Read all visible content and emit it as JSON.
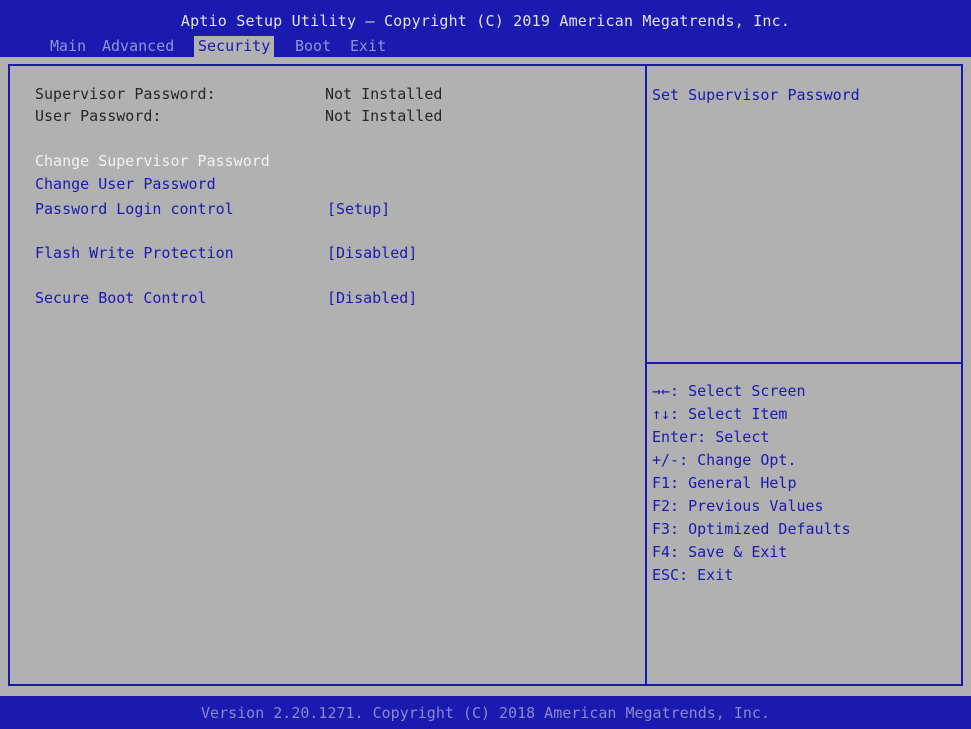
{
  "header": {
    "title": "Aptio Setup Utility – Copyright (C) 2019 American Megatrends, Inc.",
    "tabs": [
      {
        "label": "Main"
      },
      {
        "label": "Advanced"
      },
      {
        "label": "Security"
      },
      {
        "label": "Boot"
      },
      {
        "label": "Exit"
      }
    ],
    "active_tab": "Security"
  },
  "main": {
    "info": [
      {
        "label": "Supervisor Password:",
        "value": "Not Installed"
      },
      {
        "label": "User Password:",
        "value": "Not Installed"
      }
    ],
    "items": [
      {
        "label": "Change Supervisor Password",
        "value": ""
      },
      {
        "label": "Change User Password",
        "value": ""
      },
      {
        "label": "Password Login control",
        "value": "[Setup]"
      },
      {
        "label": "Flash Write Protection",
        "value": "[Disabled]"
      },
      {
        "label": "Secure Boot Control",
        "value": "[Disabled]"
      }
    ],
    "selected_item": "Change Supervisor Password"
  },
  "help": {
    "text": "Set Supervisor Password",
    "keys": [
      "→←: Select Screen",
      "↑↓: Select Item",
      "Enter: Select",
      "+/-: Change Opt.",
      "F1: General Help",
      "F2: Previous Values",
      "F3: Optimized Defaults",
      "F4: Save & Exit",
      "ESC: Exit"
    ]
  },
  "footer": {
    "text": "Version 2.20.1271. Copyright (C) 2018 American Megatrends, Inc."
  },
  "colors": {
    "background": "#b1b1b1",
    "bar": "#1a1ab0",
    "selected_text": "#f2f2f2",
    "static_text": "#262626"
  }
}
